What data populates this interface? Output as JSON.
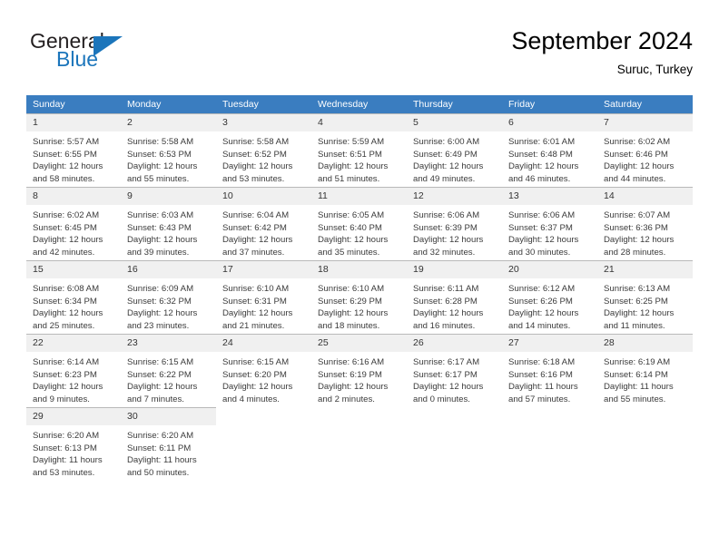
{
  "brand": {
    "line1": "General",
    "line2": "Blue",
    "accent_color": "#1b75bb"
  },
  "header": {
    "title": "September 2024",
    "subtitle": "Suruc, Turkey"
  },
  "theme": {
    "header_row_bg": "#3a7dc0",
    "daynum_bg": "#f0f0f0",
    "grid_line": "#b9b9b9"
  },
  "weekday_headers": [
    "Sunday",
    "Monday",
    "Tuesday",
    "Wednesday",
    "Thursday",
    "Friday",
    "Saturday"
  ],
  "weeks": [
    [
      {
        "day": "1",
        "sunrise": "Sunrise: 5:57 AM",
        "sunset": "Sunset: 6:55 PM",
        "daylight1": "Daylight: 12 hours",
        "daylight2": "and 58 minutes."
      },
      {
        "day": "2",
        "sunrise": "Sunrise: 5:58 AM",
        "sunset": "Sunset: 6:53 PM",
        "daylight1": "Daylight: 12 hours",
        "daylight2": "and 55 minutes."
      },
      {
        "day": "3",
        "sunrise": "Sunrise: 5:58 AM",
        "sunset": "Sunset: 6:52 PM",
        "daylight1": "Daylight: 12 hours",
        "daylight2": "and 53 minutes."
      },
      {
        "day": "4",
        "sunrise": "Sunrise: 5:59 AM",
        "sunset": "Sunset: 6:51 PM",
        "daylight1": "Daylight: 12 hours",
        "daylight2": "and 51 minutes."
      },
      {
        "day": "5",
        "sunrise": "Sunrise: 6:00 AM",
        "sunset": "Sunset: 6:49 PM",
        "daylight1": "Daylight: 12 hours",
        "daylight2": "and 49 minutes."
      },
      {
        "day": "6",
        "sunrise": "Sunrise: 6:01 AM",
        "sunset": "Sunset: 6:48 PM",
        "daylight1": "Daylight: 12 hours",
        "daylight2": "and 46 minutes."
      },
      {
        "day": "7",
        "sunrise": "Sunrise: 6:02 AM",
        "sunset": "Sunset: 6:46 PM",
        "daylight1": "Daylight: 12 hours",
        "daylight2": "and 44 minutes."
      }
    ],
    [
      {
        "day": "8",
        "sunrise": "Sunrise: 6:02 AM",
        "sunset": "Sunset: 6:45 PM",
        "daylight1": "Daylight: 12 hours",
        "daylight2": "and 42 minutes."
      },
      {
        "day": "9",
        "sunrise": "Sunrise: 6:03 AM",
        "sunset": "Sunset: 6:43 PM",
        "daylight1": "Daylight: 12 hours",
        "daylight2": "and 39 minutes."
      },
      {
        "day": "10",
        "sunrise": "Sunrise: 6:04 AM",
        "sunset": "Sunset: 6:42 PM",
        "daylight1": "Daylight: 12 hours",
        "daylight2": "and 37 minutes."
      },
      {
        "day": "11",
        "sunrise": "Sunrise: 6:05 AM",
        "sunset": "Sunset: 6:40 PM",
        "daylight1": "Daylight: 12 hours",
        "daylight2": "and 35 minutes."
      },
      {
        "day": "12",
        "sunrise": "Sunrise: 6:06 AM",
        "sunset": "Sunset: 6:39 PM",
        "daylight1": "Daylight: 12 hours",
        "daylight2": "and 32 minutes."
      },
      {
        "day": "13",
        "sunrise": "Sunrise: 6:06 AM",
        "sunset": "Sunset: 6:37 PM",
        "daylight1": "Daylight: 12 hours",
        "daylight2": "and 30 minutes."
      },
      {
        "day": "14",
        "sunrise": "Sunrise: 6:07 AM",
        "sunset": "Sunset: 6:36 PM",
        "daylight1": "Daylight: 12 hours",
        "daylight2": "and 28 minutes."
      }
    ],
    [
      {
        "day": "15",
        "sunrise": "Sunrise: 6:08 AM",
        "sunset": "Sunset: 6:34 PM",
        "daylight1": "Daylight: 12 hours",
        "daylight2": "and 25 minutes."
      },
      {
        "day": "16",
        "sunrise": "Sunrise: 6:09 AM",
        "sunset": "Sunset: 6:32 PM",
        "daylight1": "Daylight: 12 hours",
        "daylight2": "and 23 minutes."
      },
      {
        "day": "17",
        "sunrise": "Sunrise: 6:10 AM",
        "sunset": "Sunset: 6:31 PM",
        "daylight1": "Daylight: 12 hours",
        "daylight2": "and 21 minutes."
      },
      {
        "day": "18",
        "sunrise": "Sunrise: 6:10 AM",
        "sunset": "Sunset: 6:29 PM",
        "daylight1": "Daylight: 12 hours",
        "daylight2": "and 18 minutes."
      },
      {
        "day": "19",
        "sunrise": "Sunrise: 6:11 AM",
        "sunset": "Sunset: 6:28 PM",
        "daylight1": "Daylight: 12 hours",
        "daylight2": "and 16 minutes."
      },
      {
        "day": "20",
        "sunrise": "Sunrise: 6:12 AM",
        "sunset": "Sunset: 6:26 PM",
        "daylight1": "Daylight: 12 hours",
        "daylight2": "and 14 minutes."
      },
      {
        "day": "21",
        "sunrise": "Sunrise: 6:13 AM",
        "sunset": "Sunset: 6:25 PM",
        "daylight1": "Daylight: 12 hours",
        "daylight2": "and 11 minutes."
      }
    ],
    [
      {
        "day": "22",
        "sunrise": "Sunrise: 6:14 AM",
        "sunset": "Sunset: 6:23 PM",
        "daylight1": "Daylight: 12 hours",
        "daylight2": "and 9 minutes."
      },
      {
        "day": "23",
        "sunrise": "Sunrise: 6:15 AM",
        "sunset": "Sunset: 6:22 PM",
        "daylight1": "Daylight: 12 hours",
        "daylight2": "and 7 minutes."
      },
      {
        "day": "24",
        "sunrise": "Sunrise: 6:15 AM",
        "sunset": "Sunset: 6:20 PM",
        "daylight1": "Daylight: 12 hours",
        "daylight2": "and 4 minutes."
      },
      {
        "day": "25",
        "sunrise": "Sunrise: 6:16 AM",
        "sunset": "Sunset: 6:19 PM",
        "daylight1": "Daylight: 12 hours",
        "daylight2": "and 2 minutes."
      },
      {
        "day": "26",
        "sunrise": "Sunrise: 6:17 AM",
        "sunset": "Sunset: 6:17 PM",
        "daylight1": "Daylight: 12 hours",
        "daylight2": "and 0 minutes."
      },
      {
        "day": "27",
        "sunrise": "Sunrise: 6:18 AM",
        "sunset": "Sunset: 6:16 PM",
        "daylight1": "Daylight: 11 hours",
        "daylight2": "and 57 minutes."
      },
      {
        "day": "28",
        "sunrise": "Sunrise: 6:19 AM",
        "sunset": "Sunset: 6:14 PM",
        "daylight1": "Daylight: 11 hours",
        "daylight2": "and 55 minutes."
      }
    ],
    [
      {
        "day": "29",
        "sunrise": "Sunrise: 6:20 AM",
        "sunset": "Sunset: 6:13 PM",
        "daylight1": "Daylight: 11 hours",
        "daylight2": "and 53 minutes."
      },
      {
        "day": "30",
        "sunrise": "Sunrise: 6:20 AM",
        "sunset": "Sunset: 6:11 PM",
        "daylight1": "Daylight: 11 hours",
        "daylight2": "and 50 minutes."
      },
      {
        "day": "",
        "sunrise": "",
        "sunset": "",
        "daylight1": "",
        "daylight2": ""
      },
      {
        "day": "",
        "sunrise": "",
        "sunset": "",
        "daylight1": "",
        "daylight2": ""
      },
      {
        "day": "",
        "sunrise": "",
        "sunset": "",
        "daylight1": "",
        "daylight2": ""
      },
      {
        "day": "",
        "sunrise": "",
        "sunset": "",
        "daylight1": "",
        "daylight2": ""
      },
      {
        "day": "",
        "sunrise": "",
        "sunset": "",
        "daylight1": "",
        "daylight2": ""
      }
    ]
  ]
}
